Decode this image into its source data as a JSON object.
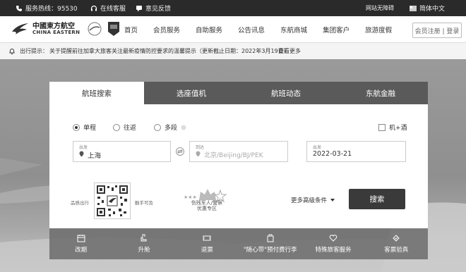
{
  "topbar": {
    "hotline": "服务热线：95530",
    "online_service": "在线客服",
    "feedback": "意见反馈",
    "accessibility": "网站无障碍",
    "language": "简体中文"
  },
  "header": {
    "logo_cn": "中國東方航空",
    "logo_en": "CHINA EASTERN",
    "nav": [
      "首页",
      "会员服务",
      "自助服务",
      "公告讯息",
      "东航商城",
      "集团客户",
      "旅游度假"
    ],
    "register_login": "会员注册 | 登录"
  },
  "notice": {
    "label": "出行提示：",
    "text": "关于提醒前往加拿大旅客关注最新疫情防控要求的温馨提示（更新截止日期：2022年3月19日）",
    "more": "查看更多"
  },
  "tabs": [
    "航班搜索",
    "选座值机",
    "航班动态",
    "东航金融"
  ],
  "search": {
    "trip_types": [
      "单程",
      "往返",
      "多段"
    ],
    "selected_trip": "单程",
    "flight_hotel": "机+酒",
    "from_label": "出发",
    "from_value": "上海",
    "to_label": "到达",
    "to_placeholder": "北京/Beijing/BJ/PEK",
    "date_label": "出发",
    "date_value": "2022-03-21",
    "qr_left": "品质出行",
    "qr_right": "触手可及",
    "military_line1": "伤残军人/警察",
    "military_line2": "优惠专区",
    "advanced": "更多高级条件",
    "search_button": "搜索"
  },
  "services": [
    "改期",
    "升舱",
    "退票",
    "\"随心带\"预付费行李",
    "特殊旅客服务",
    "客票验真"
  ]
}
